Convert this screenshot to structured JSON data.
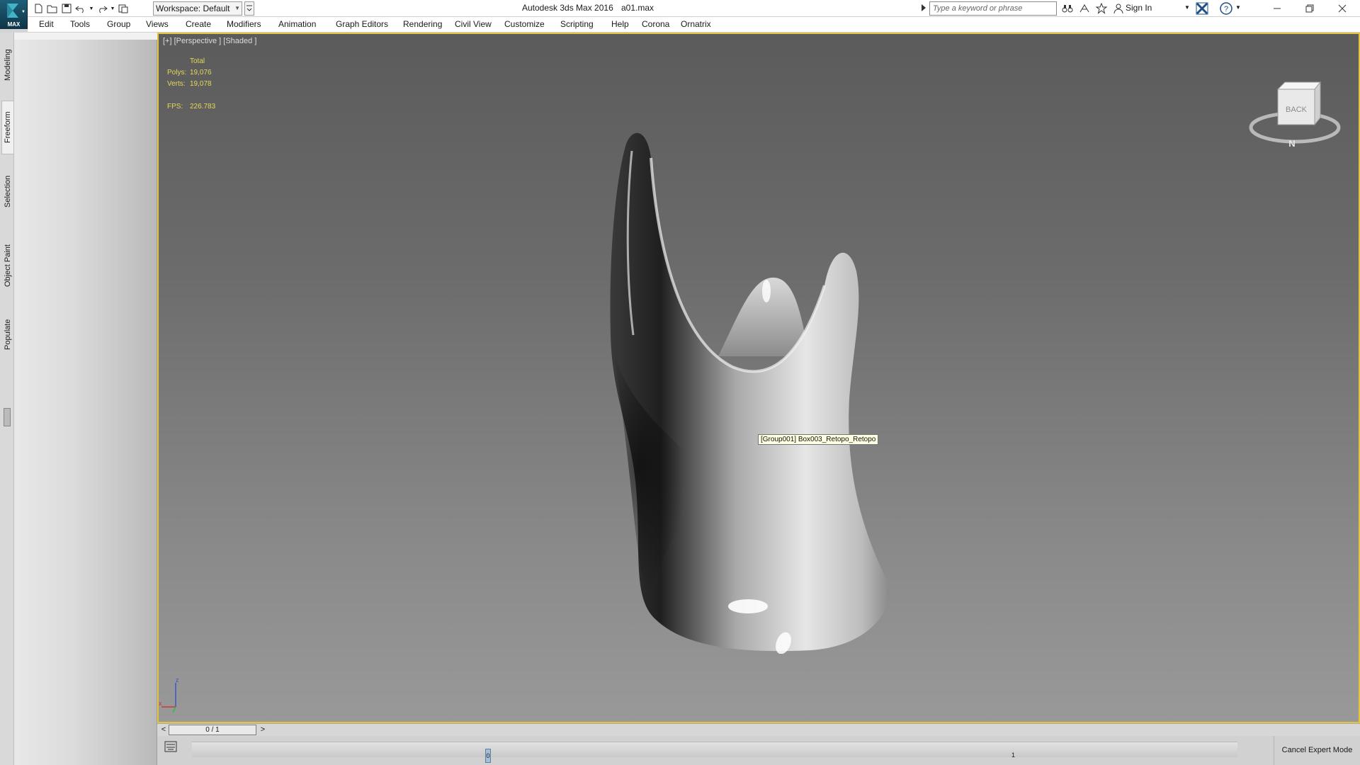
{
  "titlebar": {
    "logo_label": "MAX",
    "workspace": "Workspace: Default",
    "app_title": "Autodesk 3ds Max 2016",
    "file_name": "a01.max",
    "search_placeholder": "Type a keyword or phrase",
    "sign_in": "Sign In",
    "icons": [
      "new-file-icon",
      "open-folder-icon",
      "save-icon",
      "undo-icon",
      "redo-icon",
      "project-icon",
      "binoculars-icon",
      "people-icon",
      "star-icon",
      "person-icon",
      "exchange-icon",
      "help-icon"
    ]
  },
  "menubar": {
    "items": [
      "Edit",
      "Tools",
      "Group",
      "Views",
      "Create",
      "Modifiers",
      "Animation",
      "Graph Editors",
      "Rendering",
      "Civil View",
      "Customize",
      "Scripting",
      "Help",
      "Corona",
      "Ornatrix"
    ]
  },
  "ribbon_tabs": [
    "Modeling",
    "Freeform",
    "Selection",
    "Object Paint",
    "Populate"
  ],
  "viewport": {
    "label": "[+] [Perspective ] [Shaded ]",
    "stats": {
      "header": "Total",
      "polys_label": "Polys:",
      "polys_value": "19,076",
      "verts_label": "Verts:",
      "verts_value": "19,078",
      "fps_label": "FPS:",
      "fps_value": "226.783"
    },
    "tooltip": "[Group001] Box003_Retopo_Retopo",
    "viewcube_face": "BACK",
    "viewcube_compass": "N",
    "axis_labels": {
      "z": "z",
      "x": "x"
    }
  },
  "timeline": {
    "prev": "<",
    "next": ">",
    "frame": "0 / 1",
    "key_label": "0",
    "end_tick": "1"
  },
  "status": {
    "cancel_expert": "Cancel Expert Mode"
  }
}
